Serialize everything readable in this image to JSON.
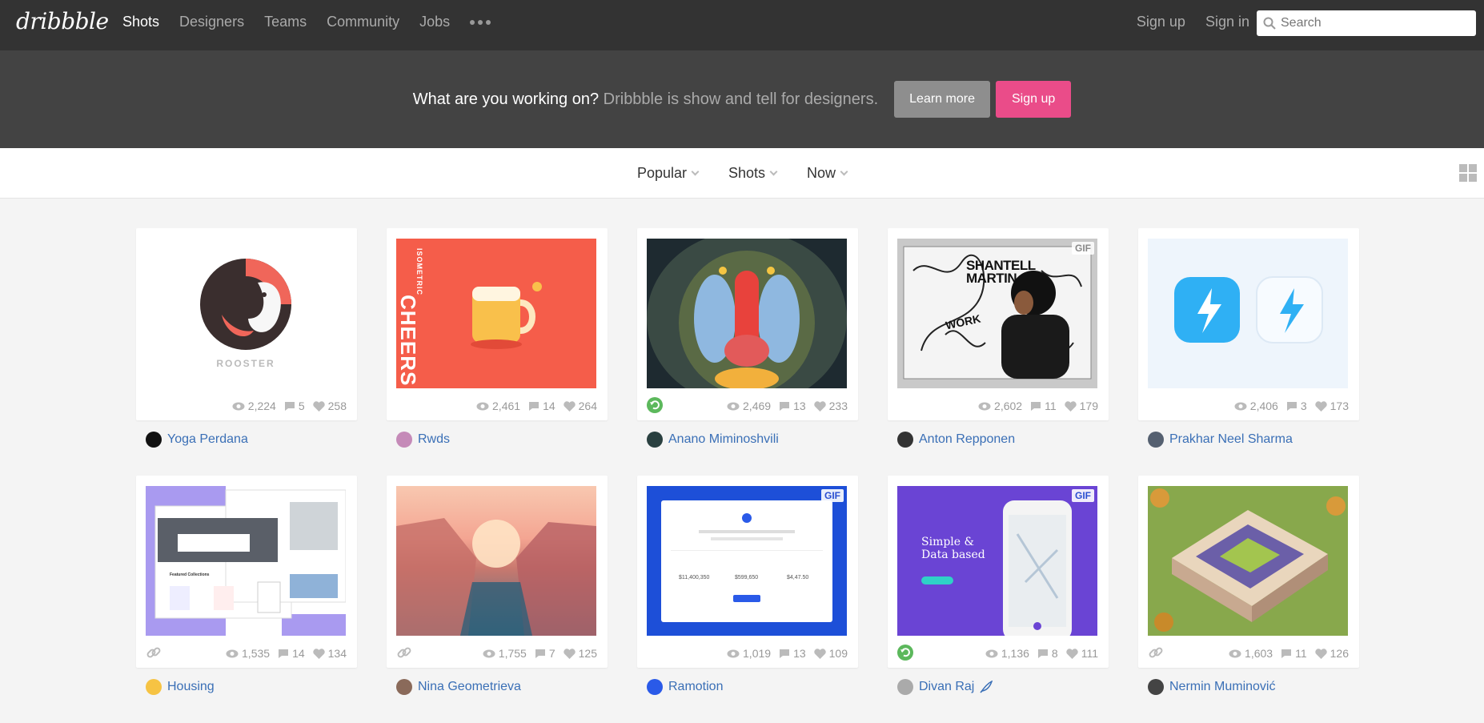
{
  "header": {
    "logo": "dribbble",
    "nav": [
      {
        "label": "Shots",
        "active": true
      },
      {
        "label": "Designers",
        "active": false
      },
      {
        "label": "Teams",
        "active": false
      },
      {
        "label": "Community",
        "active": false
      },
      {
        "label": "Jobs",
        "active": false
      }
    ],
    "sign_up": "Sign up",
    "sign_in": "Sign in",
    "search_placeholder": "Search"
  },
  "banner": {
    "question": "What are you working on?",
    "tagline": "Dribbble is show and tell for designers.",
    "learn_more": "Learn more",
    "sign_up": "Sign up"
  },
  "filters": {
    "sort": "Popular",
    "list": "Shots",
    "timeframe": "Now"
  },
  "colors": {
    "header_bg": "#333333",
    "banner_bg": "#434343",
    "accent_pink": "#ea4c89",
    "link_blue": "#3a6fb6"
  },
  "shots": [
    {
      "views": "2,224",
      "comments": "5",
      "likes": "258",
      "author": "Yoga Perdana",
      "thumb_text": "ROOSTER",
      "badge": ""
    },
    {
      "views": "2,461",
      "comments": "14",
      "likes": "264",
      "author": "Rwds",
      "thumb_text": "CHEERS",
      "thumb_sub": "ISOMETRIC",
      "badge": ""
    },
    {
      "views": "2,469",
      "comments": "13",
      "likes": "233",
      "author": "Anano Miminoshvili",
      "badge": ""
    },
    {
      "views": "2,602",
      "comments": "11",
      "likes": "179",
      "author": "Anton Repponen",
      "thumb_text": "SHANTELL MARTIN",
      "thumb_sub": "WORK",
      "badge": "GIF"
    },
    {
      "views": "2,406",
      "comments": "3",
      "likes": "173",
      "author": "Prakhar Neel Sharma",
      "badge": ""
    },
    {
      "views": "1,535",
      "comments": "14",
      "likes": "134",
      "author": "Housing",
      "thumb_text": "Featured Collections",
      "badge": ""
    },
    {
      "views": "1,755",
      "comments": "7",
      "likes": "125",
      "author": "Nina Geometrieva",
      "badge": ""
    },
    {
      "views": "1,019",
      "comments": "13",
      "likes": "109",
      "author": "Ramotion",
      "thumb_text": "$11,400,350",
      "thumb_sub": "$599,650",
      "thumb_sub2": "$4,47.50",
      "badge": "GIF"
    },
    {
      "views": "1,136",
      "comments": "8",
      "likes": "111",
      "author": "Divan Raj",
      "thumb_text": "Simple & Data based",
      "badge": "GIF"
    },
    {
      "views": "1,603",
      "comments": "11",
      "likes": "126",
      "author": "Nermin Muminović",
      "badge": ""
    }
  ]
}
